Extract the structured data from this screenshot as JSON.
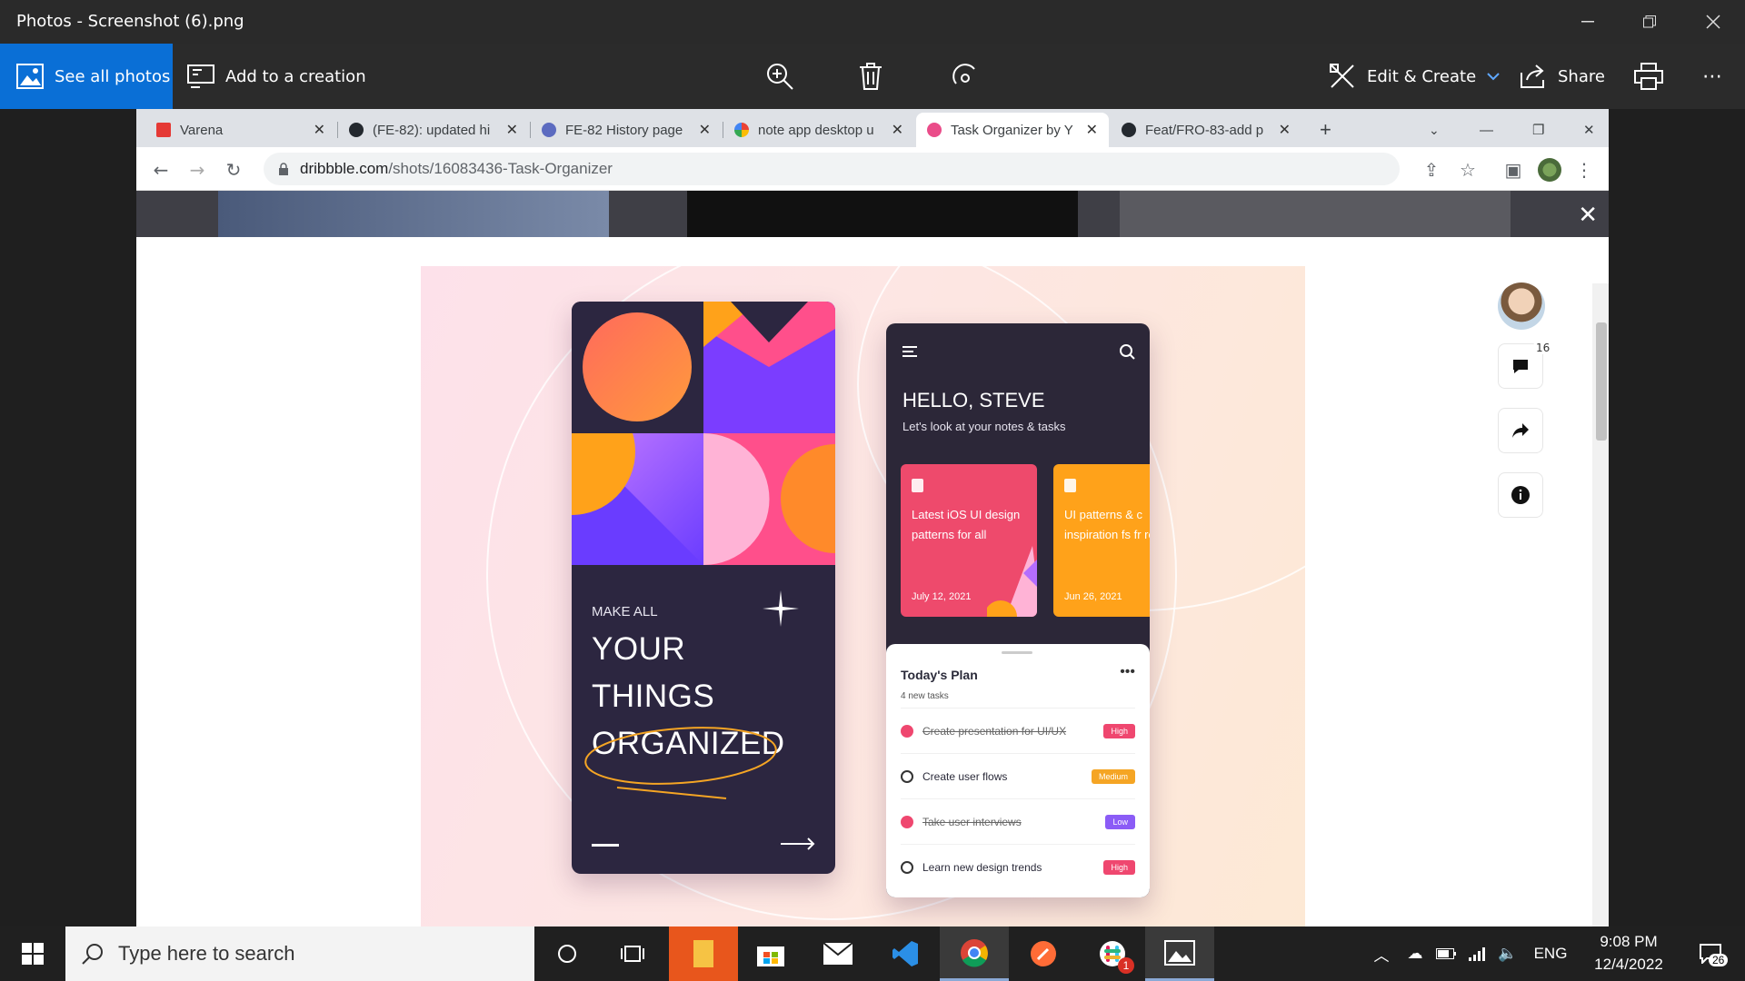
{
  "photos": {
    "title": "Photos - Screenshot (6).png",
    "see_all": "See all photos",
    "add_creation": "Add to a creation",
    "edit_create": "Edit & Create",
    "share": "Share"
  },
  "browser": {
    "tabs": [
      {
        "label": "Varena",
        "fav_color": "#e53935"
      },
      {
        "label": "(FE-82): updated hi",
        "fav_color": "#24292f"
      },
      {
        "label": "FE-82 History page",
        "fav_color": "#5c6bc0"
      },
      {
        "label": "note app desktop u",
        "fav_color": "#4285f4"
      },
      {
        "label": "Task Organizer by Y",
        "fav_color": "#ea4c89"
      },
      {
        "label": "Feat/FRO-83-add p",
        "fav_color": "#24292f"
      }
    ],
    "url_domain": "dribbble.com",
    "url_path": "/shots/16083436-Task-Organizer"
  },
  "shot": {
    "make_all": "MAKE ALL",
    "line1": "YOUR",
    "line2": "THINGS",
    "line3": "ORGANIZED",
    "hello": "HELLO, STEVE",
    "subtitle": "Let's look at your notes & tasks",
    "cards": [
      {
        "text": "Latest iOS UI design patterns for all",
        "date": "July 12, 2021",
        "color": "#ee4a6c"
      },
      {
        "text": "UI patterns & c inspiration fs fr real",
        "date": "Jun 26, 2021",
        "color": "#ffa21a"
      }
    ],
    "plan_title": "Today's Plan",
    "plan_count": "4 new tasks",
    "tasks": [
      {
        "name": "Create presentation for UI/UX",
        "badge": "High",
        "done": true,
        "color": "#ef476f"
      },
      {
        "name": "Create user flows",
        "badge": "Medium",
        "done": false,
        "color": "#f5a524"
      },
      {
        "name": "Take user interviews",
        "badge": "Low",
        "done": true,
        "color": "#8b5cf6"
      },
      {
        "name": "Learn new design trends",
        "badge": "High",
        "done": false,
        "color": "#ef476f"
      }
    ]
  },
  "side": {
    "comment_count": "16"
  },
  "taskbar": {
    "search_placeholder": "Type here to search",
    "language": "ENG",
    "time": "9:08 PM",
    "date": "12/4/2022",
    "notifications": "26",
    "slack_badge": "1"
  }
}
